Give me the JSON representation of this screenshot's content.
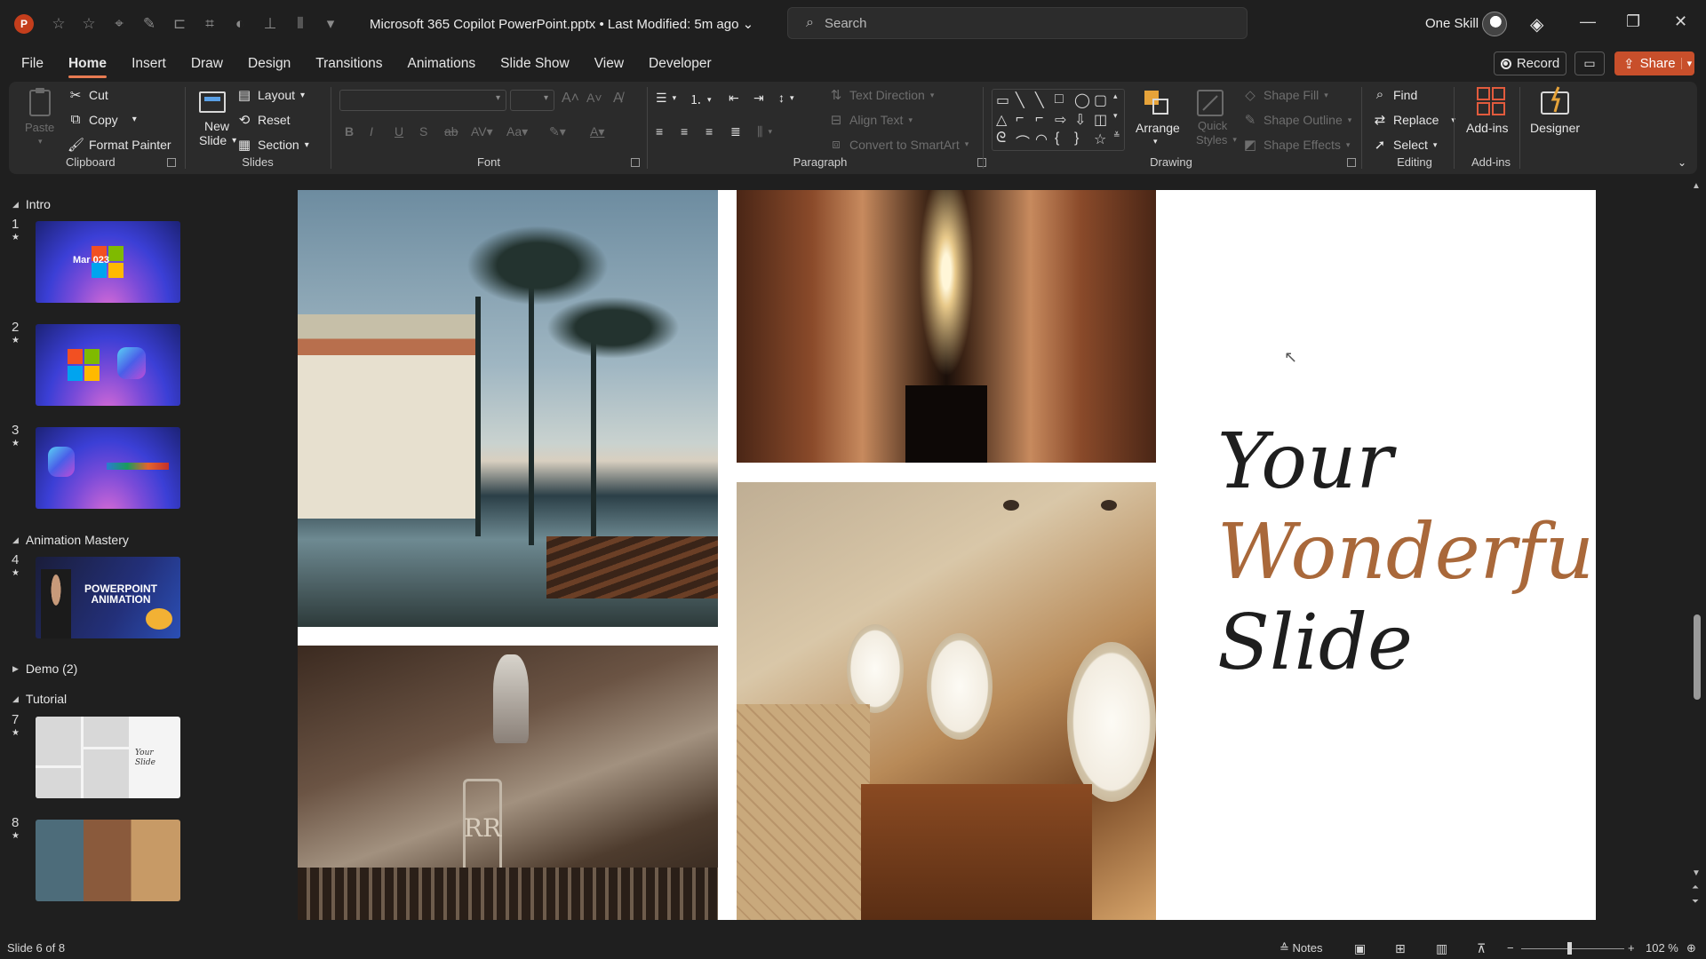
{
  "titlebar": {
    "doc_title": "Microsoft 365 Copilot PowerPoint.pptx • Last Modified: 5m ago",
    "search_placeholder": "Search",
    "user_name": "One Skill"
  },
  "tabs": [
    "File",
    "Home",
    "Insert",
    "Draw",
    "Design",
    "Transitions",
    "Animations",
    "Slide Show",
    "View",
    "Developer"
  ],
  "actions": {
    "record": "Record",
    "share": "Share"
  },
  "ribbon": {
    "clipboard": {
      "label": "Clipboard",
      "paste": "Paste",
      "cut": "Cut",
      "copy": "Copy",
      "format_painter": "Format Painter"
    },
    "slides": {
      "label": "Slides",
      "new_slide_1": "New",
      "new_slide_2": "Slide",
      "layout": "Layout",
      "reset": "Reset",
      "section": "Section"
    },
    "font": {
      "label": "Font"
    },
    "paragraph": {
      "label": "Paragraph",
      "text_direction": "Text Direction",
      "align_text": "Align Text",
      "convert_smartart": "Convert to SmartArt"
    },
    "drawing": {
      "label": "Drawing",
      "arrange": "Arrange",
      "quick_styles_1": "Quick",
      "quick_styles_2": "Styles",
      "shape_fill": "Shape Fill",
      "shape_outline": "Shape Outline",
      "shape_effects": "Shape Effects"
    },
    "editing": {
      "label": "Editing",
      "find": "Find",
      "replace": "Replace",
      "select": "Select"
    },
    "addins": {
      "label": "Add-ins",
      "addins_btn": "Add-ins",
      "designer": "Designer"
    }
  },
  "thumbnails": {
    "sections": [
      {
        "name": "Intro"
      },
      {
        "name": "Animation Mastery"
      },
      {
        "name": "Demo (2)"
      },
      {
        "name": "Tutorial"
      }
    ],
    "slides": [
      {
        "num": "1",
        "text": "Mar 023"
      },
      {
        "num": "2",
        "text": ""
      },
      {
        "num": "3",
        "text": ""
      },
      {
        "num": "4",
        "text": "POWERPOINT ANIMATION"
      },
      {
        "num": "7",
        "text": "Your Slide"
      },
      {
        "num": "8",
        "text": ""
      }
    ]
  },
  "slide": {
    "title_line1": "Your",
    "title_line2": "Wonderful",
    "title_line3": "Slide",
    "accent_color": "#a9683a"
  },
  "statusbar": {
    "slide_info": "Slide 6 of 8",
    "notes": "Notes",
    "zoom": "102 %"
  }
}
